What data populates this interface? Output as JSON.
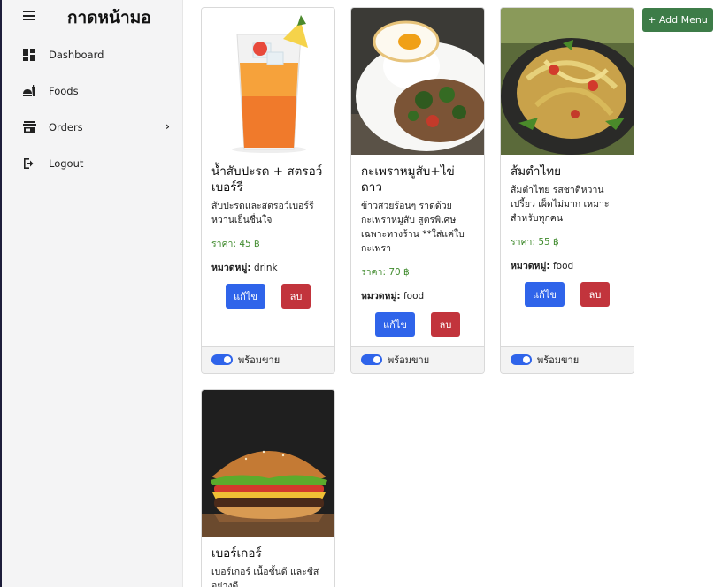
{
  "app": {
    "brand": "กาดหน้ามอ"
  },
  "sidebar": {
    "items": [
      {
        "label": "Dashboard",
        "icon": "dashboard-icon"
      },
      {
        "label": "Foods",
        "icon": "food-icon"
      },
      {
        "label": "Orders",
        "icon": "store-icon",
        "has_submenu": true
      },
      {
        "label": "Logout",
        "icon": "logout-icon"
      }
    ]
  },
  "toolbar": {
    "add_label": "+ Add Menu"
  },
  "labels": {
    "edit": "แก้ไข",
    "delete": "ลบ",
    "available": "พร้อมขาย",
    "category_prefix": "หมวดหมู่:"
  },
  "foods": [
    {
      "name": "น้ำสับปะรด + สตรอว์เบอร์รี",
      "description": "สับปะรดและสตรอว์เบอร์รี หวานเย็นชื่นใจ",
      "price": "ราคา: 45 ฿",
      "category": "drink",
      "available": true
    },
    {
      "name": "กะเพราหมูสับ+ไข่ดาว",
      "description": "ข้าวสวยร้อนๆ ราดด้วย กะเพราหมูสับ สูตรพิเศษ เฉพาะทางร้าน **ใส่แค่ใบ กะเพรา",
      "price": "ราคา: 70 ฿",
      "category": "food",
      "available": true
    },
    {
      "name": "ส้มตำไทย",
      "description": "ส้มตำไทย รสชาติหวาน เปรี้ยว เผ็ดไม่มาก เหมาะ สำหรับทุกคน",
      "price": "ราคา: 55 ฿",
      "category": "food",
      "available": true
    },
    {
      "name": "เบอร์เกอร์",
      "description": "เบอร์เกอร์ เนื้อชั้นดี และชีสอย่างดี",
      "price": "",
      "category": "",
      "available": true
    }
  ],
  "colors": {
    "accent": "#2f64ea",
    "add": "#3d7c48",
    "danger": "#c2343c",
    "price": "#3f8a2c"
  }
}
